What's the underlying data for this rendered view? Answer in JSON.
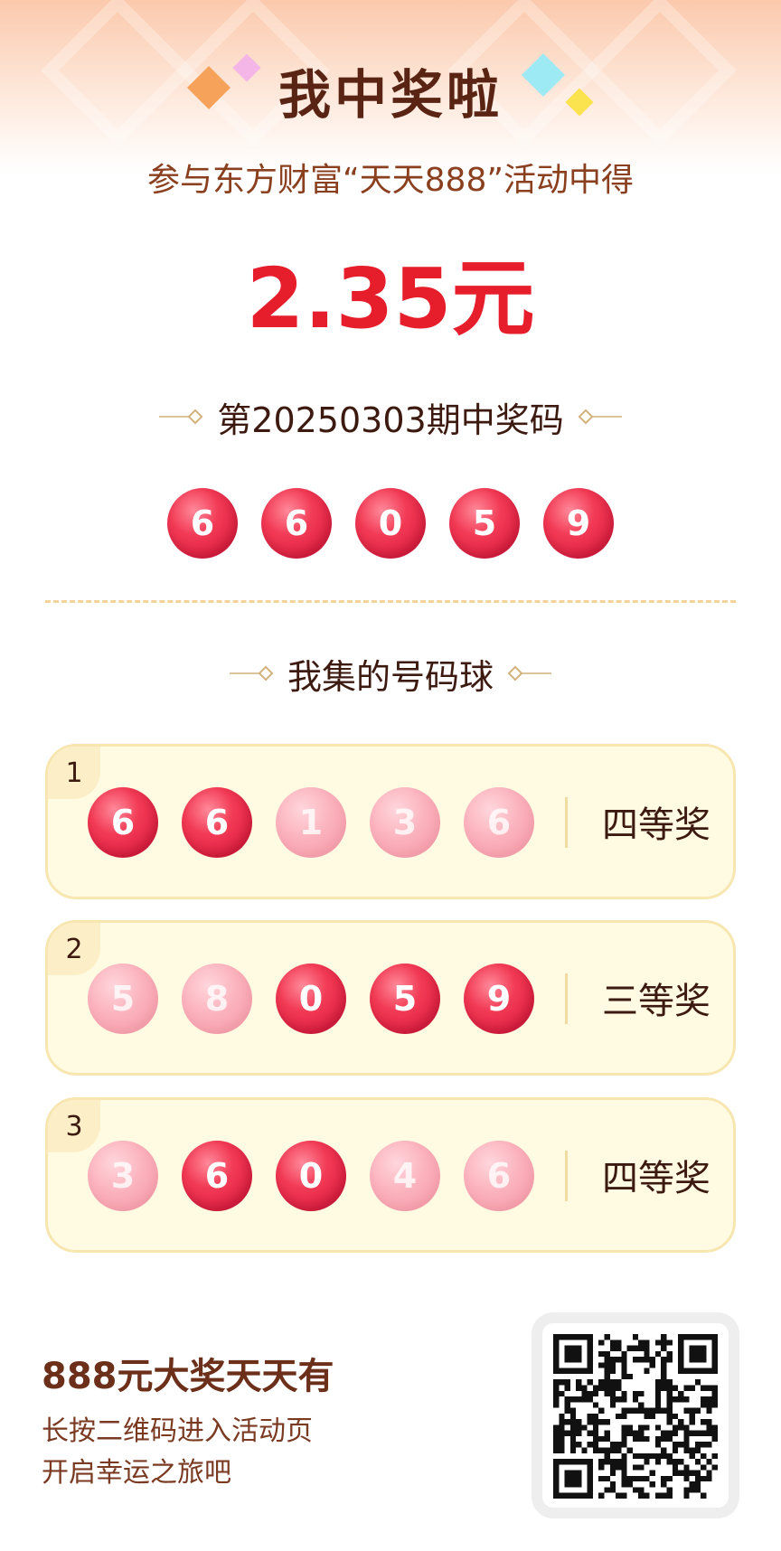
{
  "header": {
    "title": "我中奖啦",
    "subtitle": "参与东方财富“天天888”活动中得",
    "amount": "2.35元"
  },
  "winning": {
    "heading": "第20250303期中奖码",
    "numbers": [
      "6",
      "6",
      "0",
      "5",
      "9"
    ]
  },
  "collected": {
    "heading": "我集的号码球",
    "tickets": [
      {
        "index": "1",
        "balls": [
          {
            "n": "6",
            "hit": true
          },
          {
            "n": "6",
            "hit": true
          },
          {
            "n": "1",
            "hit": false
          },
          {
            "n": "3",
            "hit": false
          },
          {
            "n": "6",
            "hit": false
          }
        ],
        "prize": "四等奖"
      },
      {
        "index": "2",
        "balls": [
          {
            "n": "5",
            "hit": false
          },
          {
            "n": "8",
            "hit": false
          },
          {
            "n": "0",
            "hit": true
          },
          {
            "n": "5",
            "hit": true
          },
          {
            "n": "9",
            "hit": true
          }
        ],
        "prize": "三等奖"
      },
      {
        "index": "3",
        "balls": [
          {
            "n": "3",
            "hit": false
          },
          {
            "n": "6",
            "hit": true
          },
          {
            "n": "0",
            "hit": true
          },
          {
            "n": "4",
            "hit": false
          },
          {
            "n": "6",
            "hit": false
          }
        ],
        "prize": "四等奖"
      }
    ]
  },
  "promo": {
    "title": "888元大奖天天有",
    "line1": "长按二维码进入活动页",
    "line2": "开启幸运之旅吧"
  },
  "colors": {
    "accent_red": "#e61e2c",
    "ball_hit": "#e8284a",
    "ball_miss": "#f9b4be",
    "card_bg": "#fffbe3",
    "text_brown": "#5a2414"
  }
}
